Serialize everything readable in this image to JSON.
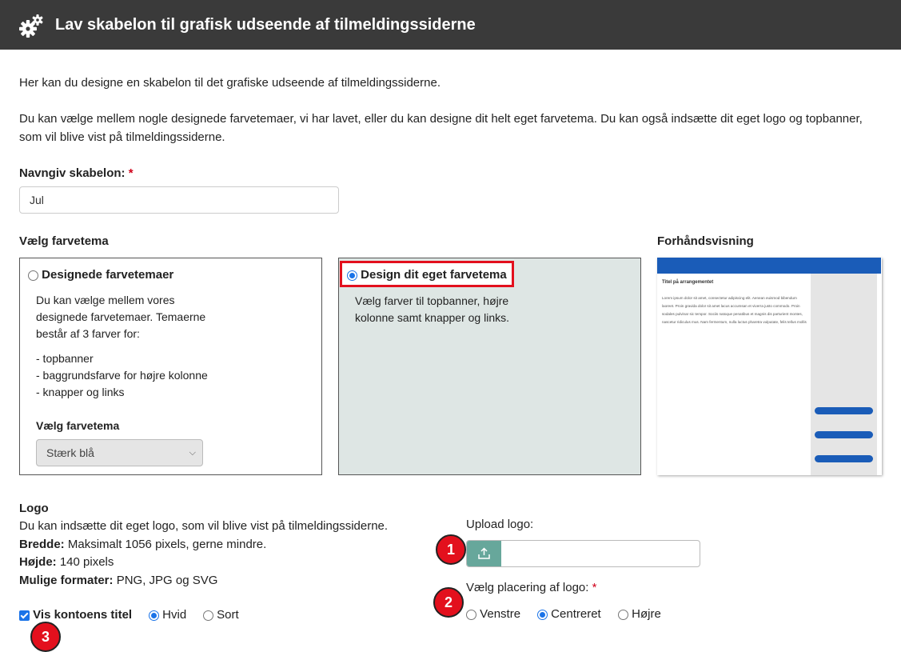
{
  "header": {
    "title": "Lav skabelon til grafisk udseende af tilmeldingssiderne",
    "icon": "gears-icon"
  },
  "intro": {
    "line1": "Her kan du designe en skabelon til det grafiske udseende af tilmeldingssiderne.",
    "line2a": "Du kan vælge mellem nogle designede farvetemaer, vi har lavet, eller du kan designe dit helt eget farvetema. Du kan også indsætte dit eget logo og topbanner,",
    "line2b": "som vil blive vist på tilmeldingssiderne."
  },
  "name_field": {
    "label": "Navngiv skabelon:",
    "required_mark": "*",
    "value": "Jul"
  },
  "theme": {
    "section_label": "Vælg farvetema",
    "designed": {
      "label": "Designede farvetemaer",
      "selected": false,
      "desc": [
        "Du kan vælge mellem vores",
        "designede farvetemaer. Temaerne",
        "består af 3 farver for:"
      ],
      "bullets": [
        "- topbanner",
        "- baggrundsfarve for højre kolonne",
        "- knapper og links"
      ],
      "select_label": "Vælg farvetema",
      "select_value": "Stærk blå"
    },
    "custom": {
      "label": "Design dit eget farvetema",
      "selected": true,
      "desc": [
        "Vælg farver til topbanner, højre",
        "kolonne samt knapper og links."
      ],
      "background": "#dee6e4"
    }
  },
  "preview": {
    "label": "Forhåndsvisning",
    "title": "Titel på arrangementet",
    "body": "Lorem ipsum dolor sit amet, consectetur adipiscing elit. Aenean euismod bibendum laoreet. Proin gravida dolor sit amet lacus accumsan et viverra justo commodo. Proin sodales pulvinar sic tempor. Sociis natoque penatibus et magnis dis parturient montes, nascetur ridiculus mus. Nam fermentum, nulla luctus pharetra vulputate, felis tellus mollis",
    "banner_color": "#1a5cb8",
    "column_color": "#e5e5e5",
    "button_color": "#1a5cb8"
  },
  "logo": {
    "heading": "Logo",
    "desc": "Du kan indsætte dit eget logo, som vil blive vist på tilmeldingssiderne.",
    "width_label": "Bredde:",
    "width_value": "Maksimalt 1056 pixels, gerne mindre.",
    "height_label": "Højde:",
    "height_value": "140 pixels",
    "formats_label": "Mulige formater:",
    "formats_value": "PNG, JPG og SVG",
    "upload_label": "Upload logo:",
    "placement_label": "Vælg placering af logo:",
    "placement_required": "*",
    "placement_options": [
      "Venstre",
      "Centreret",
      "Højre"
    ],
    "placement_selected": "Centreret"
  },
  "account_title": {
    "label": "Vis kontoens titel",
    "checked": true,
    "options": [
      "Hvid",
      "Sort"
    ],
    "selected": "Hvid"
  },
  "badges": [
    "1",
    "2",
    "3"
  ]
}
